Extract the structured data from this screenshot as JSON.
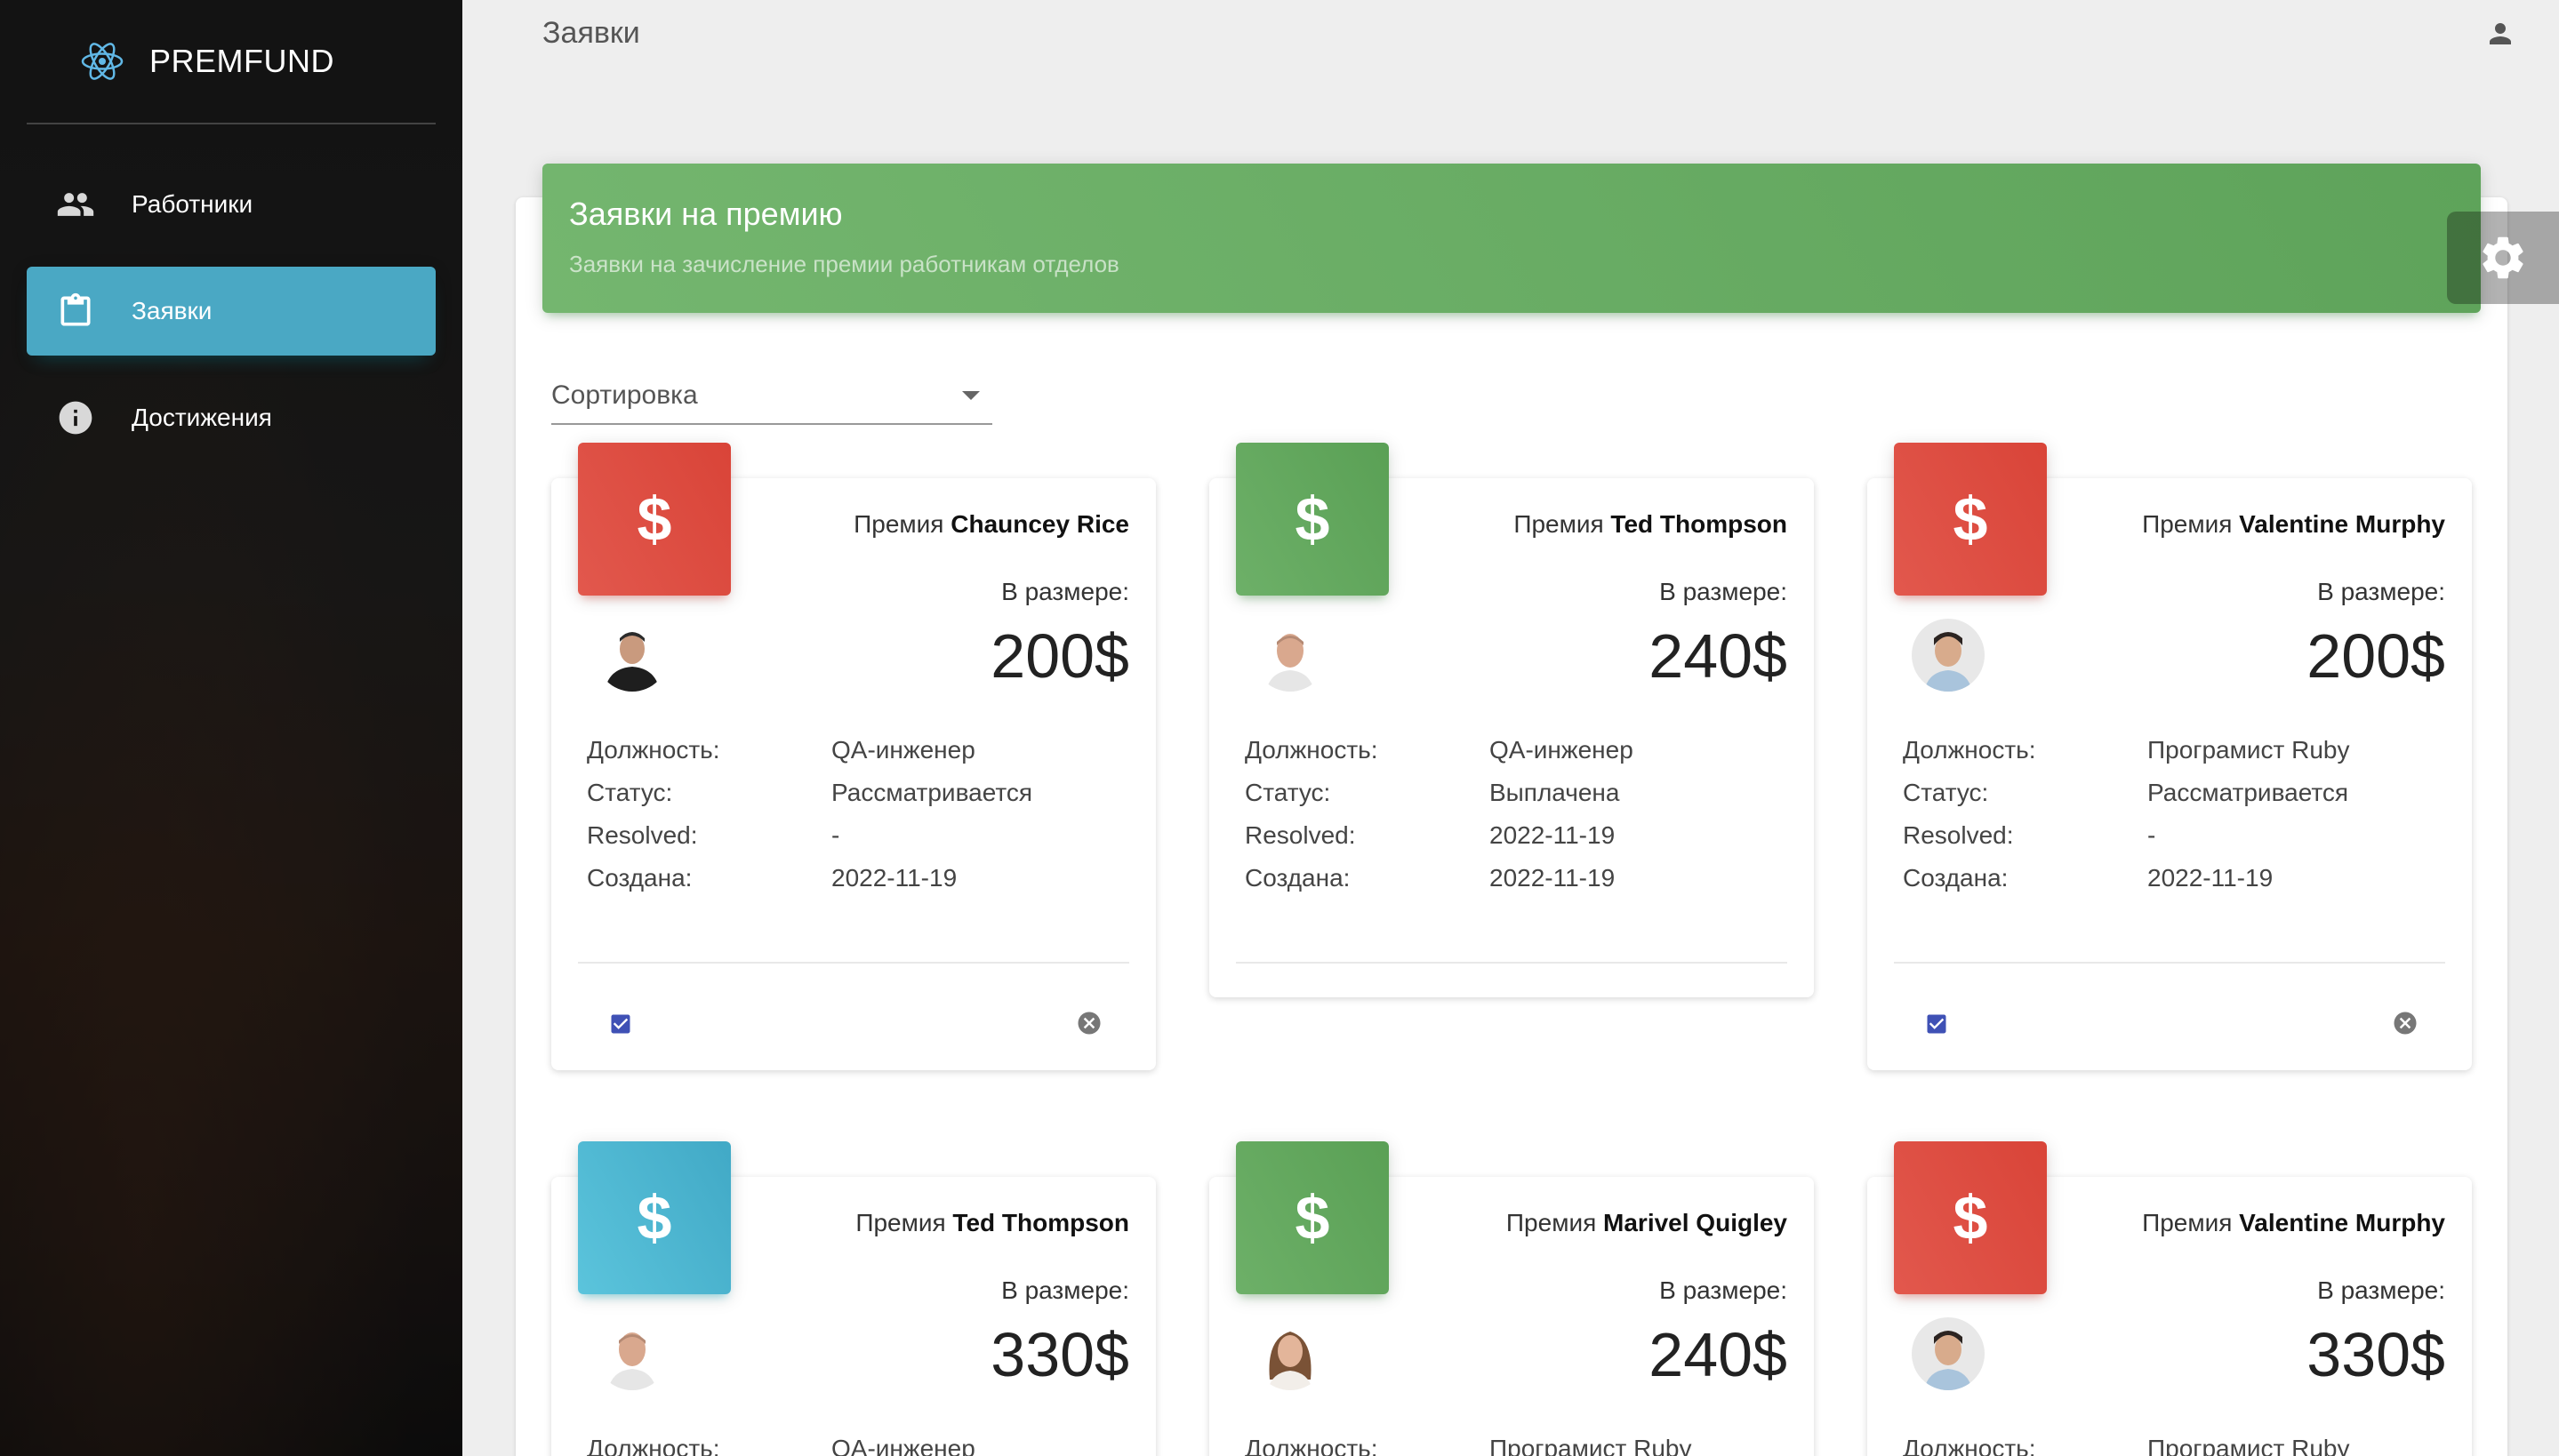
{
  "app": {
    "brand": "PREMFUND"
  },
  "sidebar": {
    "items": [
      {
        "label": "Работники",
        "icon": "people-icon",
        "active": false
      },
      {
        "label": "Заявки",
        "icon": "clipboard-icon",
        "active": true
      },
      {
        "label": "Достижения",
        "icon": "info-icon",
        "active": false
      }
    ]
  },
  "header": {
    "title": "Заявки"
  },
  "panel": {
    "title": "Заявки на премию",
    "subtitle": "Заявки на зачисление премии работникам отделов",
    "color": "#66ac61"
  },
  "sort": {
    "label": "Сортировка"
  },
  "labels": {
    "bonus_prefix": "Премия",
    "size": "В размере:",
    "position": "Должность:",
    "status": "Статус:",
    "resolved": "Resolved:",
    "created": "Создана:"
  },
  "cards": [
    {
      "name": "Chauncey Rice",
      "amount": "200$",
      "position": "QA-инженер",
      "status": "Рассматривается",
      "resolved": "-",
      "created": "2022-11-19",
      "color": "red",
      "actions": true
    },
    {
      "name": "Ted Thompson",
      "amount": "240$",
      "position": "QA-инженер",
      "status": "Выплачена",
      "resolved": "2022-11-19",
      "created": "2022-11-19",
      "color": "green",
      "actions": false
    },
    {
      "name": "Valentine Murphy",
      "amount": "200$",
      "position": "Програмист Ruby",
      "status": "Рассматривается",
      "resolved": "-",
      "created": "2022-11-19",
      "color": "red",
      "actions": true
    },
    {
      "name": "Ted Thompson",
      "amount": "330$",
      "position": "QA-инженер",
      "color": "cyan"
    },
    {
      "name": "Marivel Quigley",
      "amount": "240$",
      "position": "Програмист Ruby",
      "color": "green"
    },
    {
      "name": "Valentine Murphy",
      "amount": "330$",
      "position": "Програмист Ruby",
      "color": "red"
    }
  ]
}
